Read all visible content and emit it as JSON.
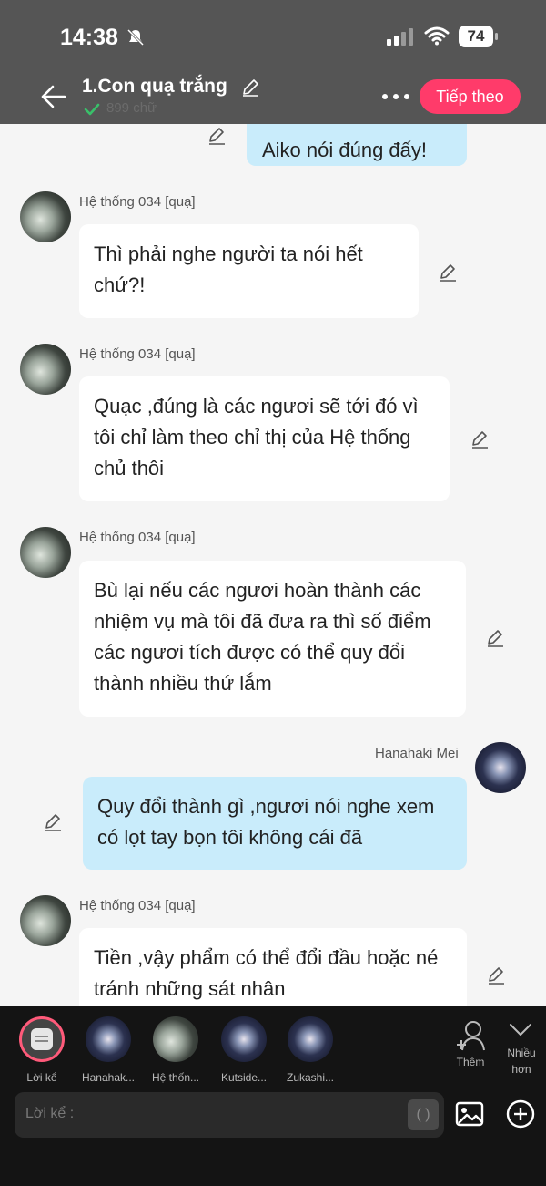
{
  "status": {
    "time": "14:38",
    "battery": "74"
  },
  "header": {
    "title": "1.Con quạ trắng",
    "word_count": "899 chữ",
    "next_label": "Tiếp theo"
  },
  "messages": [
    {
      "sender": "",
      "text": "Aiko nói đúng đấy!",
      "mine": true
    },
    {
      "sender": "Hệ thống 034 [quạ]",
      "text": "Thì phải nghe người ta nói hết chứ?!",
      "mine": false
    },
    {
      "sender": "Hệ thống 034 [quạ]",
      "text": "Quạc ,đúng là các ngươi sẽ tới đó vì tôi chỉ làm theo chỉ thị của Hệ thống chủ thôi",
      "mine": false
    },
    {
      "sender": "Hệ thống 034 [quạ]",
      "text": "Bù lại nếu các ngươi hoàn thành các nhiệm vụ mà tôi đã đưa ra thì số điểm các ngươi tích được có thể quy đổi thành nhiều thứ lắm",
      "mine": false
    },
    {
      "sender": "Hanahaki Mei",
      "text": "Quy đổi thành gì ,ngươi nói nghe xem có lọt tay bọn tôi không cái đã",
      "mine": true
    },
    {
      "sender": "Hệ thống 034 [quạ]",
      "text": "Tiền ,vậy phẩm có thể đổi đầu hoặc né tránh những sát nhân",
      "mine": false
    }
  ],
  "characters": [
    {
      "label": "Lời kể"
    },
    {
      "label": "Hanahak..."
    },
    {
      "label": "Hệ thốn..."
    },
    {
      "label": "Kutside..."
    },
    {
      "label": "Zukashi..."
    }
  ],
  "actions": {
    "add_label": "Thêm",
    "more_label": "Nhiều hơn"
  },
  "input": {
    "placeholder": "Lời kể :"
  },
  "colors": {
    "accent": "#ff3b6a",
    "mine_bubble": "#c9ecfb",
    "header_bg": "#555555"
  }
}
